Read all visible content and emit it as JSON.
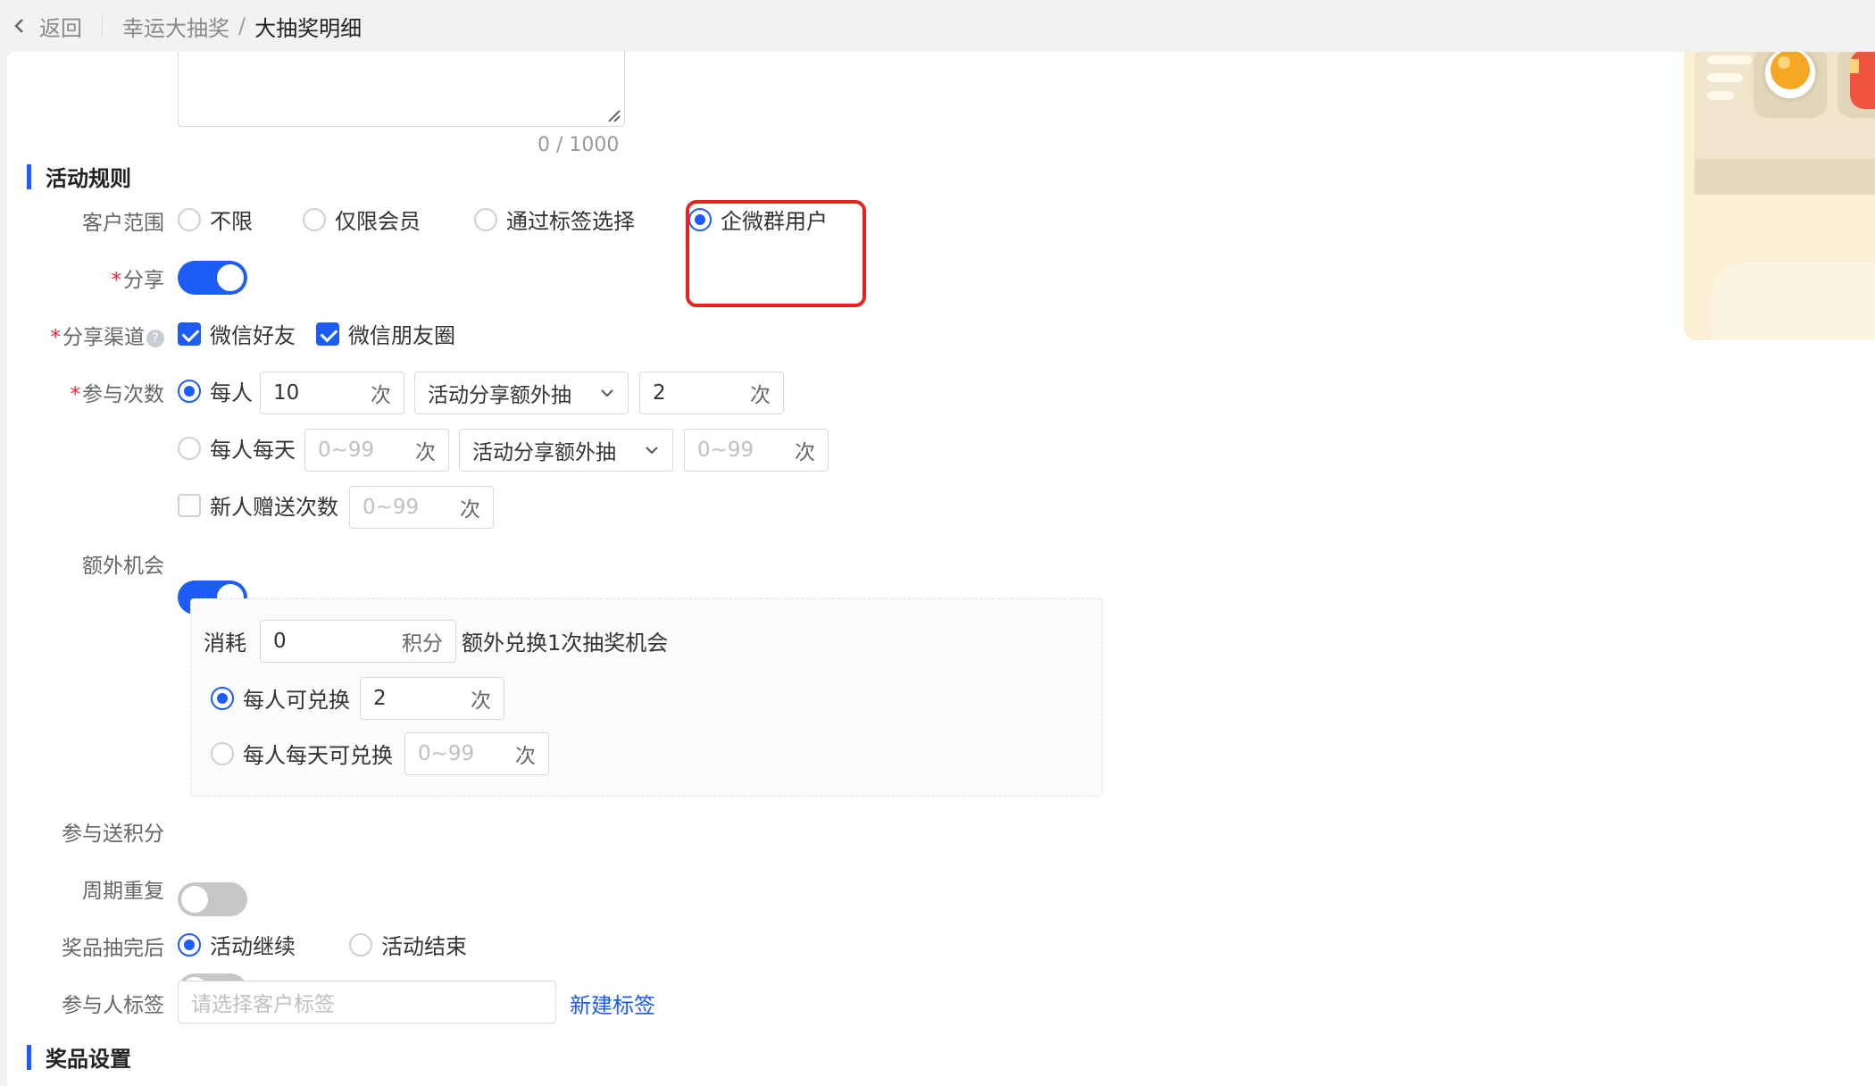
{
  "topbar": {
    "back_label": "返回",
    "breadcrumb_parent": "幸运大抽奖",
    "breadcrumb_separator": "/",
    "breadcrumb_current": "大抽奖明细"
  },
  "description": {
    "counter": "0 / 1000"
  },
  "rules_section": {
    "title": "活动规则",
    "customer_scope": {
      "label": "客户范围",
      "options": [
        "不限",
        "仅限会员",
        "通过标签选择",
        "企微群用户"
      ],
      "selected": "企微群用户"
    },
    "share": {
      "required_mark": "*",
      "label": "分享",
      "enabled": true
    },
    "share_channels": {
      "required_mark": "*",
      "label": "分享渠道",
      "help_icon": "?",
      "options": [
        {
          "label": "微信好友",
          "checked": true
        },
        {
          "label": "微信朋友圈",
          "checked": true
        }
      ]
    },
    "participation": {
      "required_mark": "*",
      "label": "参与次数",
      "per_person": {
        "label": "每人",
        "selected": true,
        "count": "10",
        "unit": "次",
        "extra_select": "活动分享额外抽",
        "extra_count": "2",
        "extra_unit": "次"
      },
      "per_person_daily": {
        "label": "每人每天",
        "selected": false,
        "placeholder": "0~99",
        "unit": "次",
        "extra_select": "活动分享额外抽",
        "extra_placeholder": "0~99",
        "extra_unit": "次"
      },
      "newbie_bonus": {
        "label": "新人赠送次数",
        "checked": false,
        "placeholder": "0~99",
        "unit": "次"
      }
    },
    "extra_chance": {
      "label": "额外机会",
      "enabled": true,
      "consume_label": "消耗",
      "consume_value": "0",
      "consume_unit": "积分",
      "consume_desc": "额外兑换1次抽奖机会",
      "per_person": {
        "label": "每人可兑换",
        "selected": true,
        "value": "2",
        "unit": "次"
      },
      "per_person_daily": {
        "label": "每人每天可兑换",
        "selected": false,
        "placeholder": "0~99",
        "unit": "次"
      }
    },
    "join_points": {
      "label": "参与送积分",
      "enabled": false
    },
    "period_repeat": {
      "label": "周期重复",
      "enabled": false
    },
    "after_prizes_drawn": {
      "label": "奖品抽完后",
      "options": [
        "活动继续",
        "活动结束"
      ],
      "selected": "活动继续"
    },
    "participant_tags": {
      "label": "参与人标签",
      "placeholder": "请选择客户标签",
      "new_tag_link": "新建标签"
    }
  },
  "prize_section": {
    "title": "奖品设置"
  },
  "colors": {
    "primary": "#1d5cf5",
    "required": "#f5222d",
    "highlight_border": "#e8231f",
    "preview_bg": "#fbf0d6"
  }
}
